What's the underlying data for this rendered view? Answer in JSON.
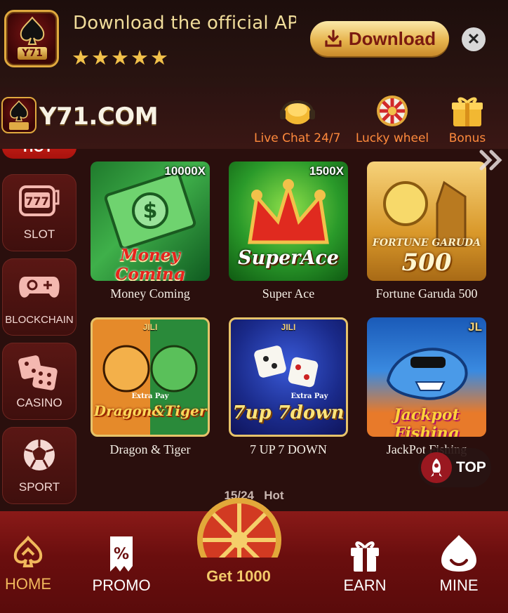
{
  "banner": {
    "title": "Download the official APP t...",
    "rating_stars": 5,
    "download_label": "Download",
    "app_icon_text": "Y71"
  },
  "header": {
    "logo_text": "Y71.COM",
    "logo_icon_text": "Y71",
    "live_chat_label": "Live Chat 24/7",
    "lucky_wheel_label": "Lucky wheel",
    "bonus_label": "Bonus"
  },
  "sidebar": {
    "items": [
      {
        "label": "HOT"
      },
      {
        "label": "SLOT"
      },
      {
        "label": "BLOCKCHAIN"
      },
      {
        "label": "CASINO"
      },
      {
        "label": "SPORT"
      }
    ]
  },
  "games": [
    {
      "name": "Money Coming",
      "multiplier": "10000X",
      "art": "Money Coming"
    },
    {
      "name": "Super Ace",
      "multiplier": "1500X",
      "art": "SuperAce"
    },
    {
      "name": "Fortune Garuda 500",
      "multiplier": "",
      "art": "FORTUNE GARUDA",
      "art2": "500"
    },
    {
      "name": "Dragon & Tiger",
      "badge": "JILI",
      "art": "Dragon&Tiger",
      "extra": "Extra Pay"
    },
    {
      "name": "7 UP 7 DOWN",
      "badge": "JILI",
      "art": "7up 7down",
      "extra": "Extra Pay"
    },
    {
      "name": "JackPot Fishing",
      "badge": "JL",
      "art": "Jackpot Fishing"
    }
  ],
  "pager": {
    "current": "15/24",
    "category": "Hot"
  },
  "top_button": {
    "label": "TOP"
  },
  "bottom_nav": {
    "home": "HOME",
    "promo": "PROMO",
    "get": "Get 1000",
    "earn": "EARN",
    "mine": "MINE"
  },
  "colors": {
    "accent_gold": "#f1b85c",
    "brand_red": "#8a1a18",
    "background": "#2a0f0d",
    "header_orange": "#ff8a3c"
  }
}
